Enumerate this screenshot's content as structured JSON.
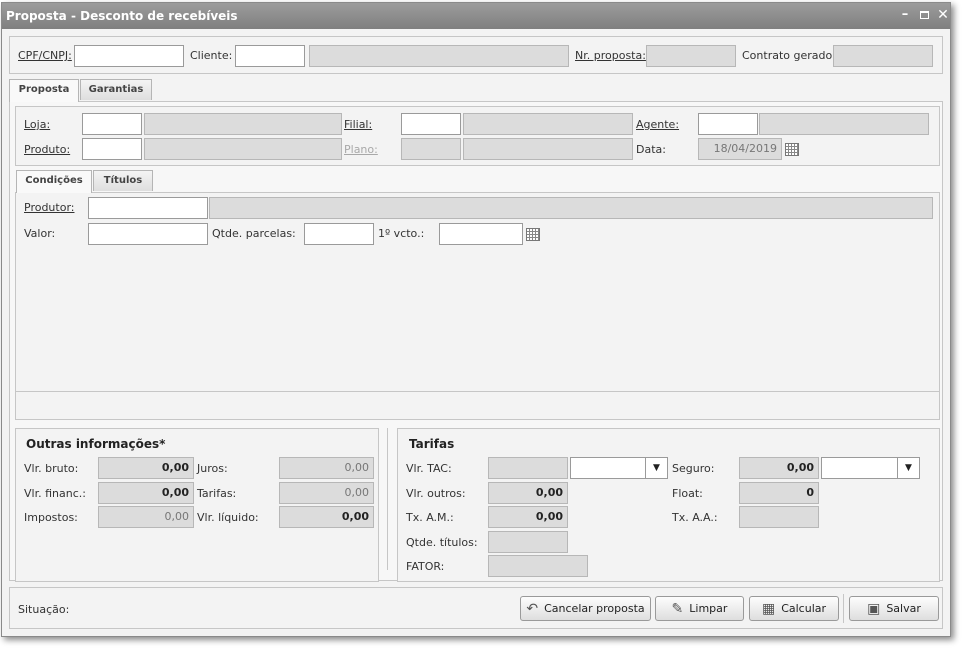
{
  "window": {
    "title": "Proposta - Desconto de recebíveis"
  },
  "header": {
    "cpf_label": "CPF/CNPJ:",
    "cliente_label": "Cliente:",
    "nr_proposta_label": "Nr. proposta:",
    "contrato_label": "Contrato gerado:"
  },
  "tabs_main": [
    {
      "label": "Proposta"
    },
    {
      "label": "Garantias"
    }
  ],
  "proposta": {
    "loja_label": "Loja:",
    "filial_label": "Filial:",
    "agente_label": "Agente:",
    "produto_label": "Produto:",
    "plano_label": "Plano:",
    "data_label": "Data:",
    "data_value": "18/04/2019"
  },
  "tabs_sub": [
    {
      "label": "Condições"
    },
    {
      "label": "Títulos"
    }
  ],
  "condicoes": {
    "produtor_label": "Produtor:",
    "valor_label": "Valor:",
    "qtde_parcelas_label": "Qtde. parcelas:",
    "vcto_label": "1º vcto.:"
  },
  "outras": {
    "title": "Outras informações*",
    "vlr_bruto_label": "Vlr. bruto:",
    "vlr_bruto": "0,00",
    "vlr_financ_label": "Vlr. financ.:",
    "vlr_financ": "0,00",
    "impostos_label": "Impostos:",
    "impostos": "0,00",
    "juros_label": "Juros:",
    "juros": "0,00",
    "tarifas_label": "Tarifas:",
    "tarifas": "0,00",
    "vlr_liquido_label": "Vlr. líquido:",
    "vlr_liquido": "0,00"
  },
  "tarifas": {
    "title": "Tarifas",
    "vlr_tac_label": "Vlr. TAC:",
    "vlr_outros_label": "Vlr. outros:",
    "vlr_outros": "0,00",
    "tx_am_label": "Tx. A.M.:",
    "tx_am": "0,00",
    "qtde_titulos_label": "Qtde. títulos:",
    "fator_label": "FATOR:",
    "seguro_label": "Seguro:",
    "seguro": "0,00",
    "float_label": "Float:",
    "float": "0",
    "tx_aa_label": "Tx. A.A.:"
  },
  "footer": {
    "situacao_label": "Situação:",
    "cancelar_label": "Cancelar proposta",
    "limpar_label": "Limpar",
    "calcular_label": "Calcular",
    "salvar_label": "Salvar"
  }
}
